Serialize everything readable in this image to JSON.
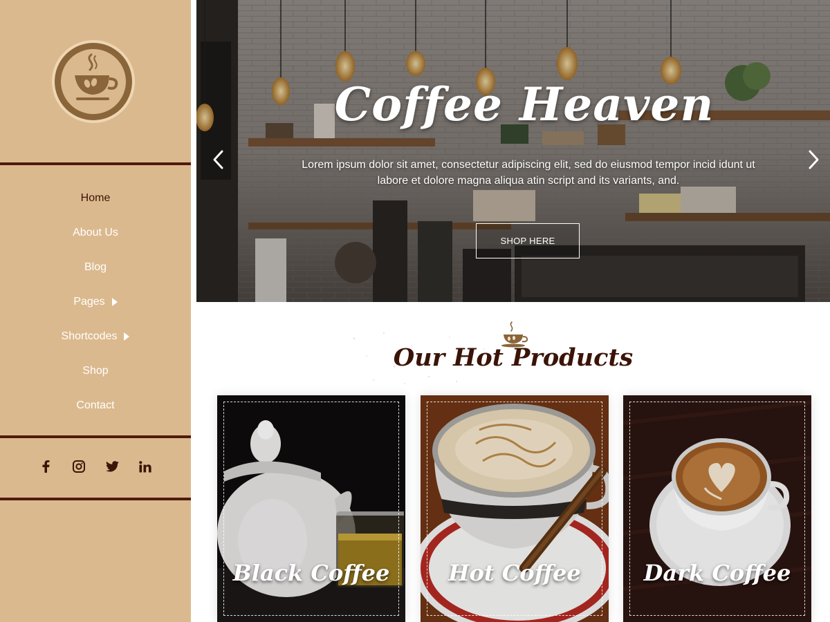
{
  "brand": {
    "logo_icon": "coffee-cup-logo-icon",
    "colors": {
      "sidebar_bg": "#dbb98e",
      "accent_dark": "#4f1b0b",
      "logo_ring": "#8a6539"
    }
  },
  "sidebar": {
    "nav": [
      {
        "label": "Home",
        "active": true
      },
      {
        "label": "About Us"
      },
      {
        "label": "Blog"
      },
      {
        "label": "Pages",
        "has_submenu": true
      },
      {
        "label": "Shortcodes",
        "has_submenu": true
      },
      {
        "label": "Shop"
      },
      {
        "label": "Contact"
      }
    ],
    "social": [
      "facebook-icon",
      "instagram-icon",
      "twitter-icon",
      "linkedin-icon"
    ]
  },
  "hero": {
    "title": "Coffee Heaven",
    "text": "Lorem ipsum dolor sit amet, consectetur adipiscing elit, sed do eiusmod tempor incid idunt ut labore et dolore magna aliqua atin script and its variants, and.",
    "button_label": "SHOP HERE",
    "prev_icon": "chevron-left-icon",
    "next_icon": "chevron-right-icon"
  },
  "products_section": {
    "title": "Our Hot Products",
    "icon": "coffee-cup-icon",
    "products": [
      {
        "name": "Black Coffee"
      },
      {
        "name": "Hot Coffee"
      },
      {
        "name": "Dark Coffee"
      }
    ]
  }
}
